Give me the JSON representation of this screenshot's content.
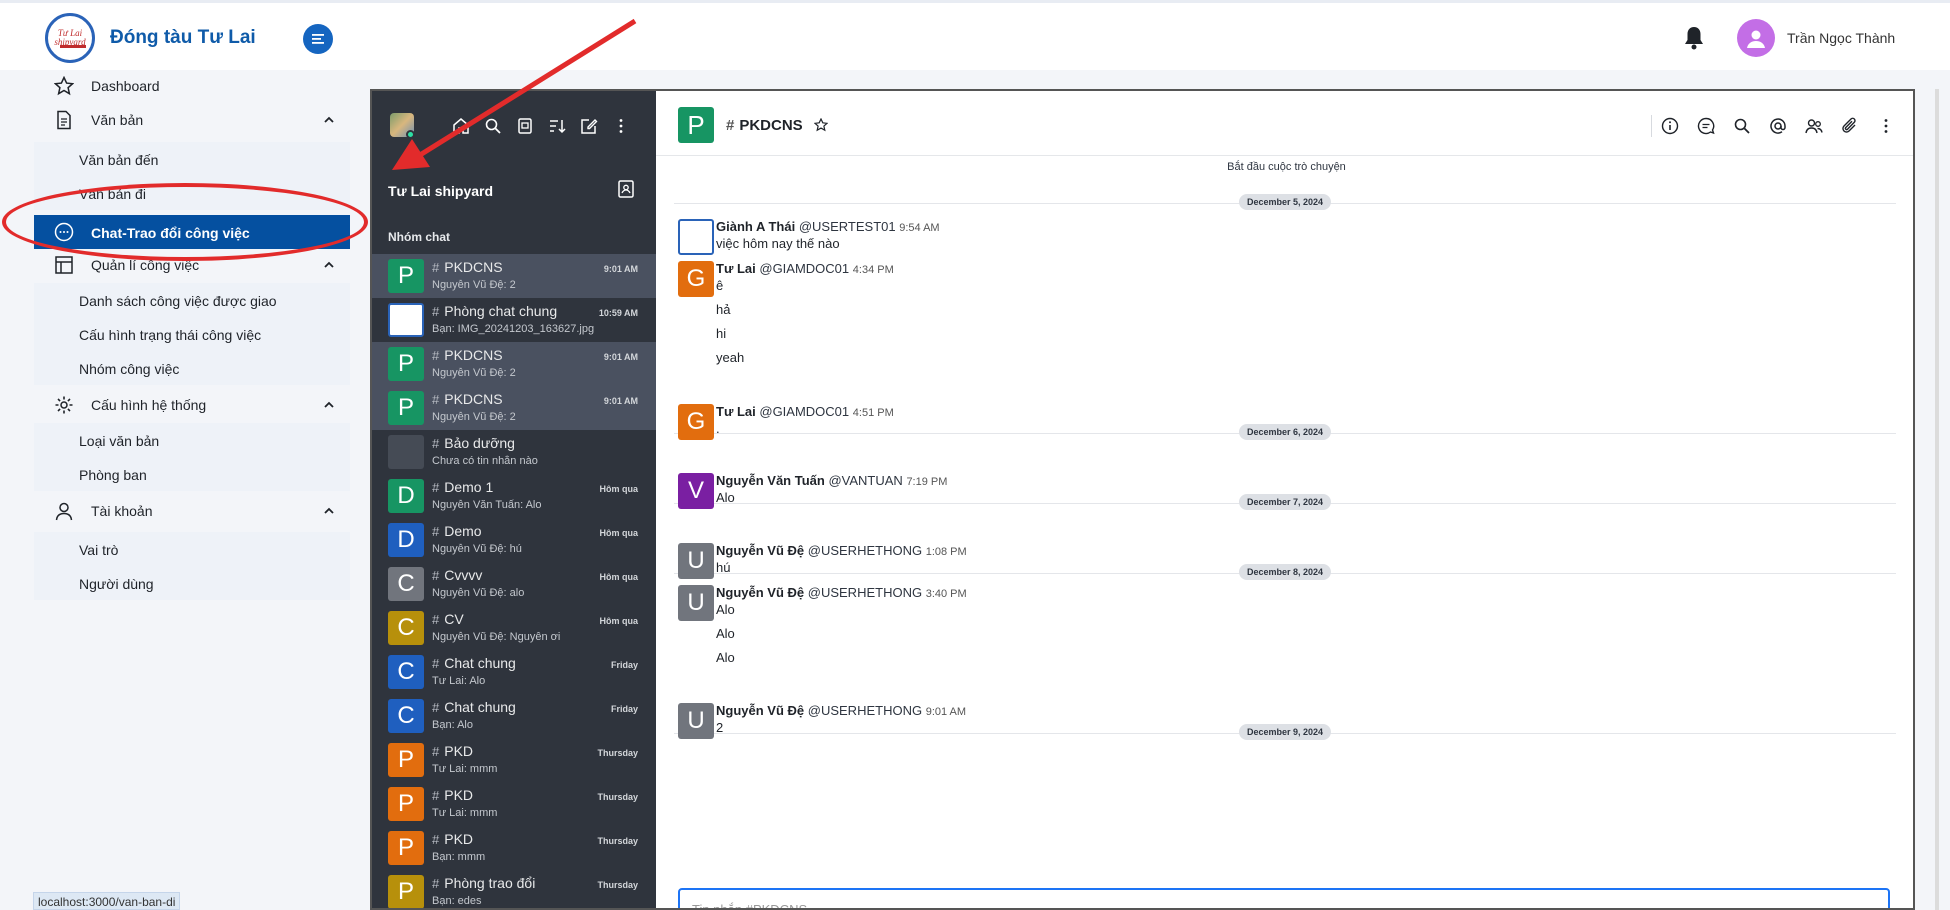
{
  "app": {
    "brand": "Đóng tàu Tư Lai",
    "user_name": "Trần Ngọc Thành",
    "logo_text": "Tư Lai shipyard"
  },
  "sidebar": {
    "dashboard": "Dashboard",
    "van_ban": "Văn bản",
    "van_ban_den": "Văn bản đến",
    "van_ban_di": "Văn bản đi",
    "chat": "Chat-Trao đổi công việc",
    "quan_li": "Quản lí công việc",
    "ds_cv": "Danh sách công việc được giao",
    "cau_hinh_tt": "Cấu hình trạng thái công việc",
    "nhom_cv": "Nhóm công việc",
    "cau_hinh_ht": "Cấu hình hệ thống",
    "loai_vb": "Loại văn bản",
    "phong_ban": "Phòng ban",
    "tai_khoan": "Tài khoản",
    "vai_tro": "Vai trò",
    "nguoi_dung": "Người dùng"
  },
  "status_url": "localhost:3000/van-ban-di",
  "chat_sidebar": {
    "workspace": "Tư Lai shipyard",
    "section": "Nhóm chat",
    "rooms": [
      {
        "initial": "P",
        "color": "#179563",
        "name": "PKDCNS",
        "msg": "Nguyễn Vũ Đệ: 2",
        "time": "9:01 AM",
        "selected": true
      },
      {
        "initial": "",
        "color": "#ffffff",
        "name": "Phòng chat chung",
        "msg": "Bạn: IMG_20241203_163627.jpg",
        "time": "10:59 AM",
        "selected": false
      },
      {
        "initial": "P",
        "color": "#179563",
        "name": "PKDCNS",
        "msg": "Nguyễn Vũ Đệ: 2",
        "time": "9:01 AM",
        "selected": true
      },
      {
        "initial": "P",
        "color": "#179563",
        "name": "PKDCNS",
        "msg": "Nguyễn Vũ Đệ: 2",
        "time": "9:01 AM",
        "selected": true
      },
      {
        "initial": "",
        "color": "#454b55",
        "name": "Bảo dưỡng",
        "msg": "Chưa có tin nhắn nào",
        "time": "",
        "selected": false
      },
      {
        "initial": "D",
        "color": "#179563",
        "name": "Demo 1",
        "msg": "Nguyễn Văn Tuấn: Alo",
        "time": "Hôm qua",
        "selected": false
      },
      {
        "initial": "D",
        "color": "#1f5fbf",
        "name": "Demo",
        "msg": "Nguyễn Vũ Đệ: hú",
        "time": "Hôm qua",
        "selected": false
      },
      {
        "initial": "C",
        "color": "#71757d",
        "name": "Cvvvv",
        "msg": "Nguyễn Vũ Đệ: alo",
        "time": "Hôm qua",
        "selected": false
      },
      {
        "initial": "C",
        "color": "#b7900b",
        "name": "CV",
        "msg": "Nguyễn Vũ Đệ: Nguyên ơi",
        "time": "Hôm qua",
        "selected": false
      },
      {
        "initial": "C",
        "color": "#1f5fbf",
        "name": "Chat chung",
        "msg": "Tư Lai: Alo",
        "time": "Friday",
        "selected": false
      },
      {
        "initial": "C",
        "color": "#1f5fbf",
        "name": "Chat chung",
        "msg": "Bạn: Alo",
        "time": "Friday",
        "selected": false
      },
      {
        "initial": "P",
        "color": "#e26d0e",
        "name": "PKD",
        "msg": "Tư Lai: mmm",
        "time": "Thursday",
        "selected": false
      },
      {
        "initial": "P",
        "color": "#e26d0e",
        "name": "PKD",
        "msg": "Tư Lai: mmm",
        "time": "Thursday",
        "selected": false
      },
      {
        "initial": "P",
        "color": "#e26d0e",
        "name": "PKD",
        "msg": "Bạn: mmm",
        "time": "Thursday",
        "selected": false
      },
      {
        "initial": "P",
        "color": "#b7900b",
        "name": "Phòng trao đổi",
        "msg": "Bạn: edes",
        "time": "Thursday",
        "selected": false
      }
    ]
  },
  "chat": {
    "room_initial": "P",
    "room_name": "PKDCNS",
    "start_text": "Bắt đầu cuộc trò chuyện",
    "composer_placeholder": "Tin nhắn #PKDCNS",
    "dates": [
      "December 5, 2024",
      "December 6, 2024",
      "December 7, 2024",
      "December 8, 2024",
      "December 9, 2024"
    ],
    "messages": [
      {
        "initial": "",
        "color": "#ffffff",
        "name": "Giành A Thái",
        "handle": "@USERTEST01",
        "time": "9:54 AM",
        "lines": [
          "việc hôm nay thế nào"
        ]
      },
      {
        "initial": "G",
        "color": "#e26d0e",
        "name": "Tư Lai",
        "handle": "@GIAMDOC01",
        "time": "4:34 PM",
        "lines": [
          "ê",
          "hả",
          "hi",
          "yeah"
        ]
      },
      {
        "initial": "G",
        "color": "#e26d0e",
        "name": "Tư Lai",
        "handle": "@GIAMDOC01",
        "time": "4:51 PM",
        "lines": [
          "."
        ]
      },
      {
        "initial": "V",
        "color": "#7a1fa2",
        "name": "Nguyễn Văn Tuấn",
        "handle": "@VANTUAN",
        "time": "7:19 PM",
        "lines": [
          "Alo"
        ]
      },
      {
        "initial": "U",
        "color": "#71757d",
        "name": "Nguyễn Vũ Đệ",
        "handle": "@USERHETHONG",
        "time": "1:08 PM",
        "lines": [
          "hú"
        ]
      },
      {
        "initial": "U",
        "color": "#71757d",
        "name": "Nguyễn Vũ Đệ",
        "handle": "@USERHETHONG",
        "time": "3:40 PM",
        "lines": [
          "Alo",
          "Alo",
          "Alo"
        ]
      },
      {
        "initial": "U",
        "color": "#71757d",
        "name": "Nguyễn Vũ Đệ",
        "handle": "@USERHETHONG",
        "time": "9:01 AM",
        "lines": [
          "2"
        ]
      }
    ]
  },
  "icons": [
    "bell-icon",
    "home-icon",
    "search-icon",
    "directory-icon",
    "sort-icon",
    "edit-icon",
    "kebab-icon",
    "info-icon",
    "threads-icon",
    "mention-icon",
    "members-icon",
    "attachment-icon",
    "star-icon"
  ]
}
